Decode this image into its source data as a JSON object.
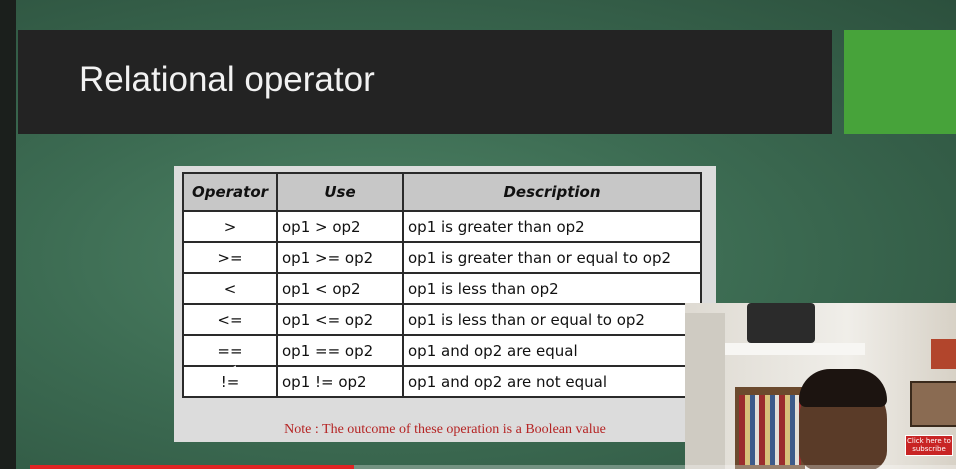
{
  "slide": {
    "title": "Relational operator",
    "table": {
      "headers": [
        "Operator",
        "Use",
        "Description"
      ],
      "rows": [
        [
          ">",
          "op1 > op2",
          "op1 is greater than op2"
        ],
        [
          ">=",
          "op1 >= op2",
          "op1 is greater than or equal to op2"
        ],
        [
          "<",
          "op1 < op2",
          "op1 is less than op2"
        ],
        [
          "<=",
          "op1 <= op2",
          "op1 is less than or equal to op2"
        ],
        [
          "==",
          "op1 == op2",
          "op1 and op2 are equal"
        ],
        [
          "!=",
          "op1 != op2",
          "op1 and op2 are not equal"
        ]
      ]
    },
    "note": "Note : The outcome of these operation is a Boolean value"
  },
  "subscribe_label": "Click here to subscribe",
  "video_progress": 0.35,
  "colors": {
    "title_bar": "#232323",
    "accent_green": "#47a33a",
    "note_red": "#b52424",
    "progress_red": "#e02424"
  }
}
